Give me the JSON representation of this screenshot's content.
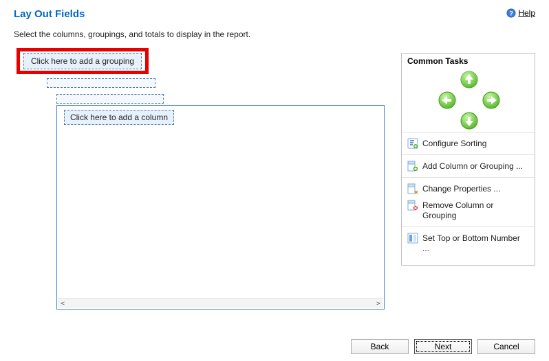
{
  "header": {
    "title": "Lay Out Fields",
    "help_label": "Help"
  },
  "instruction": "Select the columns, groupings, and totals to display in the report.",
  "placeholders": {
    "add_grouping": "Click here to add a grouping",
    "add_column": "Click here to add a column"
  },
  "side_panel": {
    "title": "Common Tasks",
    "arrows": {
      "up": "move-up",
      "down": "move-down",
      "left": "move-left",
      "right": "move-right"
    },
    "groups": [
      [
        {
          "icon": "sort-icon",
          "label": "Configure Sorting"
        }
      ],
      [
        {
          "icon": "add-column-icon",
          "label": "Add Column or Grouping ..."
        }
      ],
      [
        {
          "icon": "properties-icon",
          "label": "Change Properties ..."
        },
        {
          "icon": "remove-column-icon",
          "label": "Remove Column or Grouping"
        }
      ],
      [
        {
          "icon": "set-top-icon",
          "label": "Set Top or Bottom Number ..."
        }
      ]
    ]
  },
  "footer": {
    "back": "Back",
    "next": "Next",
    "cancel": "Cancel"
  },
  "colors": {
    "accent": "#0066cc",
    "highlight": "#e60000",
    "arrow_green": "#4caf1f",
    "dashed_border": "#4a7ab8"
  }
}
